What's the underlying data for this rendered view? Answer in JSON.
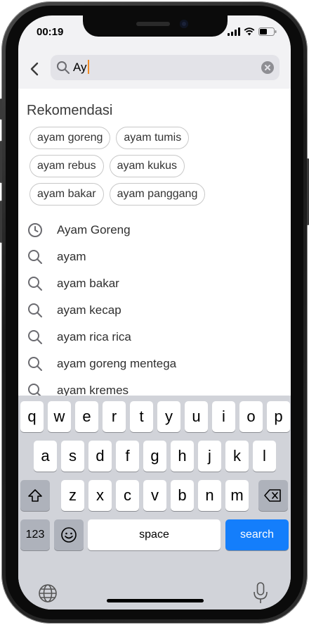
{
  "status_bar": {
    "time": "00:19"
  },
  "search": {
    "value": "Ay"
  },
  "recommendations": {
    "title": "Rekomendasi",
    "rows": [
      [
        "ayam goreng",
        "ayam tumis"
      ],
      [
        "ayam rebus",
        "ayam kukus"
      ],
      [
        "ayam bakar",
        "ayam panggang"
      ]
    ]
  },
  "suggestions": [
    {
      "icon": "clock-icon",
      "text": "Ayam Goreng"
    },
    {
      "icon": "search-icon",
      "text": "ayam"
    },
    {
      "icon": "search-icon",
      "text": "ayam bakar"
    },
    {
      "icon": "search-icon",
      "text": "ayam kecap"
    },
    {
      "icon": "search-icon",
      "text": "ayam rica rica"
    },
    {
      "icon": "search-icon",
      "text": "ayam goreng mentega"
    },
    {
      "icon": "search-icon",
      "text": "ayam kremes"
    }
  ],
  "keyboard": {
    "row1": [
      "q",
      "w",
      "e",
      "r",
      "t",
      "y",
      "u",
      "i",
      "o",
      "p"
    ],
    "row2": [
      "a",
      "s",
      "d",
      "f",
      "g",
      "h",
      "j",
      "k",
      "l"
    ],
    "row3": [
      "z",
      "x",
      "c",
      "v",
      "b",
      "n",
      "m"
    ],
    "numbers_key": "123",
    "space_key": "space",
    "search_key": "search"
  },
  "colors": {
    "accent": "#147efb",
    "caret": "#f08a24"
  }
}
